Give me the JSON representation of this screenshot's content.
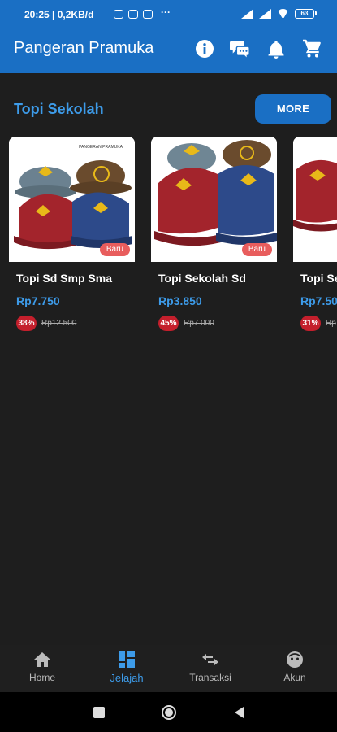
{
  "status": {
    "time": "20:25 | 0,2KB/d",
    "more": "···",
    "battery": "63"
  },
  "app_title": "Pangeran Pramuka",
  "section": {
    "title": "Topi Sekolah",
    "more_label": "MORE"
  },
  "products": [
    {
      "name": "Topi Sd Smp Sma",
      "price": "Rp7.750",
      "discount": "38%",
      "old_price": "Rp12.500",
      "badge": "Baru",
      "brand_text": "PANGERAN PRAMUKA"
    },
    {
      "name": "Topi Sekolah Sd",
      "price": "Rp3.850",
      "discount": "45%",
      "old_price": "Rp7.000",
      "badge": "Baru"
    },
    {
      "name": "Topi Se",
      "price": "Rp7.50",
      "discount": "31%",
      "old_price": "Rp"
    }
  ],
  "nav": [
    {
      "label": "Home",
      "icon": "home-icon"
    },
    {
      "label": "Jelajah",
      "icon": "grid-icon",
      "active": true
    },
    {
      "label": "Transaksi",
      "icon": "swap-icon"
    },
    {
      "label": "Akun",
      "icon": "face-icon"
    }
  ],
  "colors": {
    "primary": "#1a6fc4",
    "accent": "#3d9be9",
    "discount": "#c41f2c",
    "badge": "#e85d5d",
    "background": "#1e1e1e"
  }
}
